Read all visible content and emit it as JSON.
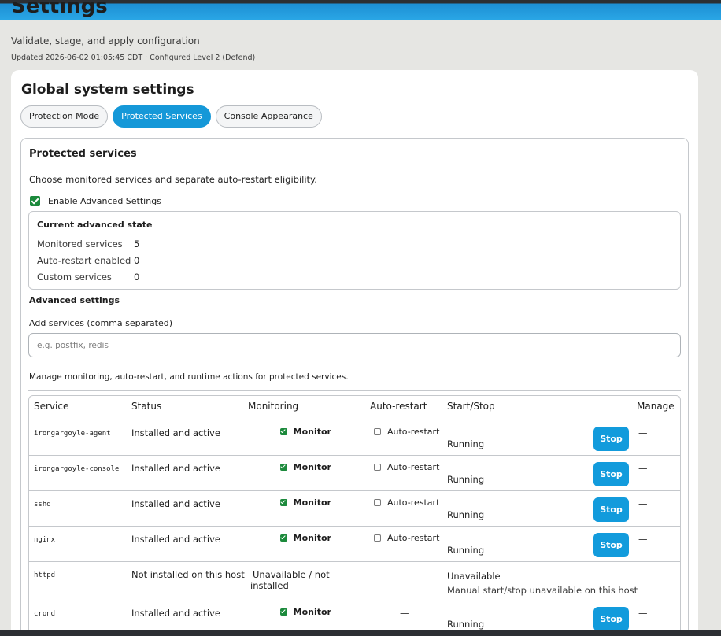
{
  "page": {
    "title": "Settings",
    "subtitle": "Validate, stage, and apply configuration",
    "updated": "Updated 2026-06-02 01:05:45 CDT · Configured Level 2 (Defend)"
  },
  "card": {
    "title": "Global system settings",
    "tabs": [
      {
        "label": "Protection Mode",
        "active": false
      },
      {
        "label": "Protected Services",
        "active": true
      },
      {
        "label": "Console Appearance",
        "active": false
      }
    ]
  },
  "panel": {
    "title": "Protected services",
    "description": "Choose monitored services and separate auto-restart eligibility.",
    "enable_advanced": {
      "label": "Enable Advanced Settings",
      "checked": true
    },
    "state": {
      "title": "Current advanced state",
      "monitored_label": "Monitored services",
      "monitored_value": "5",
      "autorestart_label": "Auto-restart enabled",
      "autorestart_value": "0",
      "custom_label": "Custom services",
      "custom_value": "0"
    },
    "advanced_title": "Advanced settings",
    "add_label": "Add services (comma separated)",
    "add_placeholder": "e.g. postfix, redis",
    "manage_description": "Manage monitoring, auto-restart, and runtime actions for protected services."
  },
  "table": {
    "headers": {
      "service": "Service",
      "status": "Status",
      "monitoring": "Monitoring",
      "autorestart": "Auto-restart",
      "startstop": "Start/Stop",
      "manage": "Manage"
    },
    "rows": [
      {
        "service": "irongargoyle-agent",
        "status": "Installed and active",
        "monitor_label": "Monitor",
        "auto_label": "Auto-restart",
        "state": "Running",
        "stop_label": "Stop",
        "manage": "—"
      },
      {
        "service": "irongargoyle-console",
        "status": "Installed and active",
        "monitor_label": "Monitor",
        "auto_label": "Auto-restart",
        "state": "Running",
        "stop_label": "Stop",
        "manage": "—"
      },
      {
        "service": "sshd",
        "status": "Installed and active",
        "monitor_label": "Monitor",
        "auto_label": "Auto-restart",
        "state": "Running",
        "stop_label": "Stop",
        "manage": "—"
      },
      {
        "service": "nginx",
        "status": "Installed and active",
        "monitor_label": "Monitor",
        "auto_label": "Auto-restart",
        "state": "Running",
        "stop_label": "Stop",
        "manage": "—"
      },
      {
        "service": "httpd",
        "status": "Not installed on this host",
        "monitoring": "Unavailable / not installed",
        "auto": "—",
        "state": "Unavailable",
        "state_note": "Manual start/stop unavailable on this host",
        "manage": "—"
      },
      {
        "service": "crond",
        "status": "Installed and active",
        "monitor_label": "Monitor",
        "auto": "—",
        "state": "Running",
        "stop_label": "Stop",
        "manage": "—"
      }
    ]
  },
  "colors": {
    "accent": "#129bdc",
    "check_green": "#1c8a3c",
    "topbar": "#2aa7e6"
  }
}
